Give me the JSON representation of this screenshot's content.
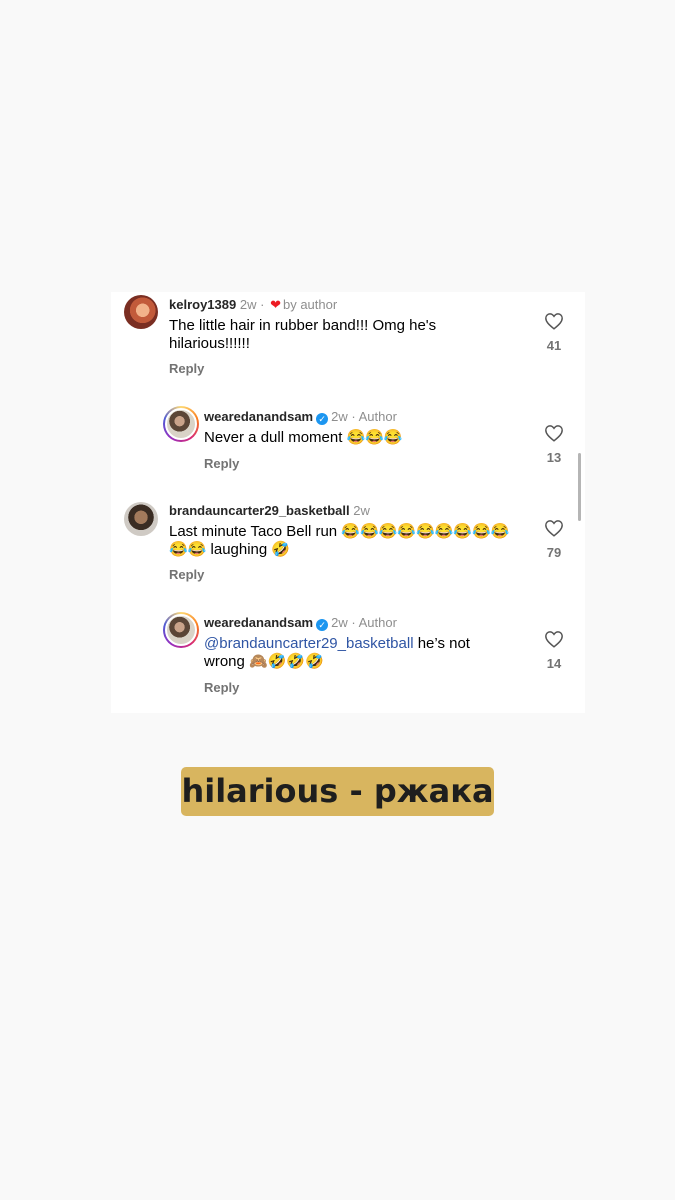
{
  "comments": [
    {
      "username": "kelroy1389",
      "time": "2w",
      "separator": "·",
      "badge": "by author",
      "text": "The little hair in rubber band!!! Omg he's hilarious!!!!!!",
      "reply_label": "Reply",
      "likes": "41",
      "avatar_icon": "user-avatar"
    },
    {
      "username": "wearedanandsam",
      "time": "2w",
      "separator": "·",
      "badge": "Author",
      "text": "Never a dull moment 😂😂😂",
      "reply_label": "Reply",
      "likes": "13",
      "avatar_icon": "user-avatar-story-ring"
    },
    {
      "username": "brandauncarter29_basketball",
      "time": "2w",
      "text": "Last minute Taco Bell run 😂😂😂😂😂😂😂😂😂😂😂 laughing 🤣",
      "reply_label": "Reply",
      "likes": "79",
      "avatar_icon": "user-avatar"
    },
    {
      "username": "wearedanandsam",
      "time": "2w",
      "separator": "·",
      "badge": "Author",
      "mention": "@brandauncarter29_basketball",
      "text": " he’s not wrong 🙈🤣🤣🤣",
      "reply_label": "Reply",
      "likes": "14",
      "avatar_icon": "user-avatar-story-ring"
    }
  ],
  "caption": "hilarious - ржака",
  "colors": {
    "background": "#f9f9f9",
    "card": "#ffffff",
    "caption_box": "#d8b55f",
    "mention": "#2f55a4",
    "liked_heart": "#ed1c24",
    "verified": "#1c96f0"
  }
}
